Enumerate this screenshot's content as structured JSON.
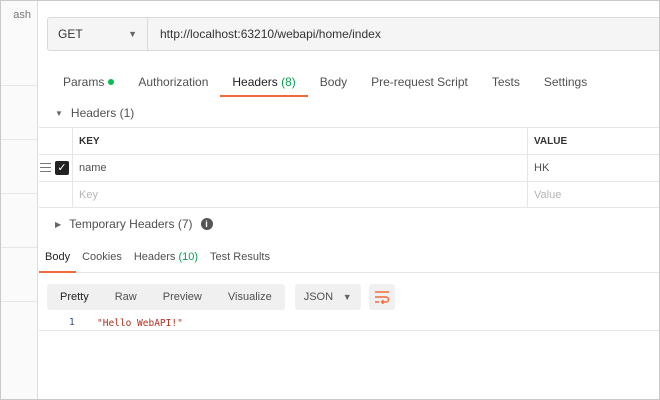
{
  "sidebar": {
    "snippet": "ash"
  },
  "request": {
    "method": "GET",
    "url": "http://localhost:63210/webapi/home/index"
  },
  "tabs": [
    {
      "label": "Params",
      "dot": true
    },
    {
      "label": "Authorization"
    },
    {
      "label": "Headers",
      "count": "(8)",
      "active": true
    },
    {
      "label": "Body"
    },
    {
      "label": "Pre-request Script"
    },
    {
      "label": "Tests"
    },
    {
      "label": "Settings"
    }
  ],
  "headers_section": {
    "title": "Headers",
    "count": "(1)",
    "columns": {
      "key": "KEY",
      "value": "VALUE"
    },
    "rows": [
      {
        "key": "name",
        "value": "HK",
        "checked": true
      }
    ],
    "placeholder": {
      "key": "Key",
      "value": "Value"
    }
  },
  "temporary_headers": {
    "label": "Temporary Headers",
    "count": "(7)"
  },
  "response": {
    "tabs": [
      {
        "label": "Body",
        "active": true
      },
      {
        "label": "Cookies"
      },
      {
        "label": "Headers",
        "count": "(10)"
      },
      {
        "label": "Test Results"
      }
    ],
    "view_modes": [
      "Pretty",
      "Raw",
      "Preview",
      "Visualize"
    ],
    "active_view": "Pretty",
    "format": "JSON",
    "lines": [
      {
        "number": "1",
        "text": "\"Hello WebAPI!\""
      }
    ]
  },
  "colors": {
    "accent": "#f26b3a",
    "count_green": "#0a9e56",
    "string_red": "#b0301f"
  }
}
